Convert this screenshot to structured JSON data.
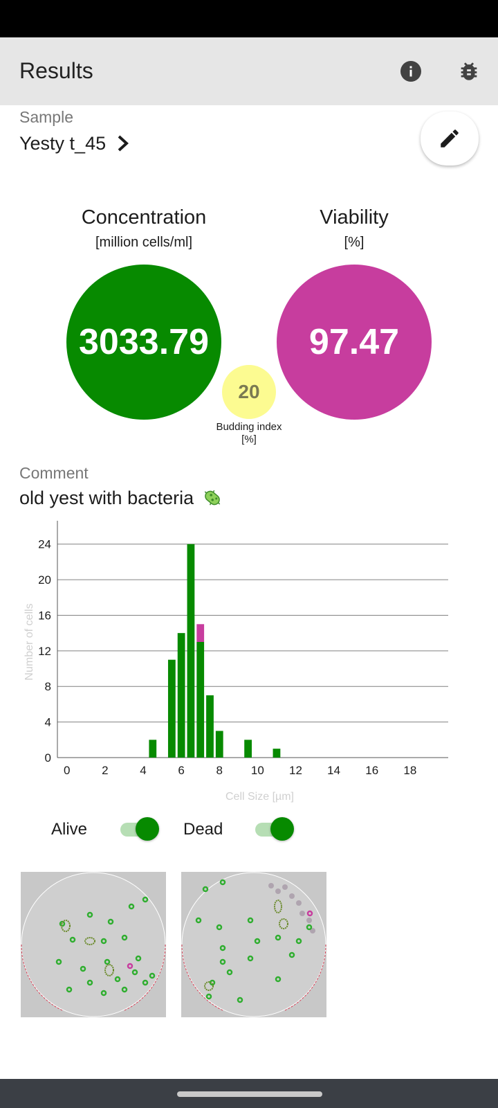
{
  "app_bar": {
    "title": "Results",
    "info_icon": "info-icon",
    "debug_icon": "bug-icon"
  },
  "sample": {
    "label": "Sample",
    "name": "Yesty t_45"
  },
  "concentration": {
    "title": "Concentration",
    "unit": "[million cells/ml]",
    "value": "3033.79",
    "color": "#078a00"
  },
  "viability": {
    "title": "Viability",
    "unit": "[%]",
    "value": "97.47",
    "color": "#c73d9e"
  },
  "budding": {
    "value": "20",
    "label_line1": "Budding index",
    "label_line2": "[%]",
    "color": "#fcfb91"
  },
  "comment": {
    "label": "Comment",
    "text": "old yest with bacteria",
    "emoji_icon": "microbe-icon"
  },
  "chart_data": {
    "type": "bar",
    "stacked": true,
    "xlabel": "Cell Size [µm]",
    "ylabel": "Number of cells",
    "xlim": [
      -0.5,
      20
    ],
    "ylim": [
      0,
      26
    ],
    "x_ticks": [
      0,
      2,
      4,
      6,
      8,
      10,
      12,
      14,
      16,
      18
    ],
    "y_ticks": [
      0,
      4,
      8,
      12,
      16,
      20,
      24
    ],
    "grid": true,
    "bin_width": 0.5,
    "series": [
      {
        "name": "Alive",
        "color": "#078a00",
        "x": [
          4.5,
          5.5,
          6.0,
          6.5,
          7.0,
          7.5,
          8.0,
          9.5,
          11.0
        ],
        "values": [
          2,
          11,
          14,
          24,
          13,
          7,
          3,
          2,
          1
        ]
      },
      {
        "name": "Dead",
        "color": "#c73d9e",
        "x": [
          4.5,
          5.5,
          6.0,
          6.5,
          7.0,
          7.5,
          8.0,
          9.5,
          11.0
        ],
        "values": [
          0,
          0,
          0,
          0,
          2,
          0,
          0,
          0,
          0
        ]
      }
    ]
  },
  "filters": {
    "alive_label": "Alive",
    "alive_on": true,
    "dead_label": "Dead",
    "dead_on": true
  },
  "images": [
    {
      "name": "sample-image-1"
    },
    {
      "name": "sample-image-2"
    }
  ]
}
